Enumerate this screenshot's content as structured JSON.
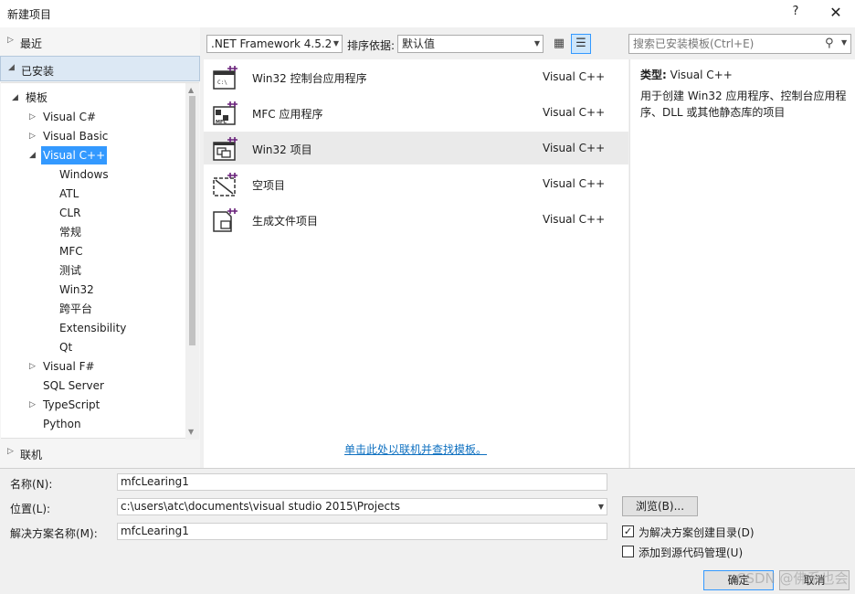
{
  "window": {
    "title": "新建项目",
    "help": "?",
    "close": "✕"
  },
  "nav": {
    "recent": "最近",
    "installed": "已安装",
    "online": "联机",
    "tree": [
      {
        "label": "模板",
        "arrow": "◢"
      },
      {
        "label": "Visual C#",
        "arrow": "▷"
      },
      {
        "label": "Visual Basic",
        "arrow": "▷"
      },
      {
        "label": "Visual C++",
        "arrow": "◢"
      },
      {
        "label": "Windows"
      },
      {
        "label": "ATL"
      },
      {
        "label": "CLR"
      },
      {
        "label": "常规"
      },
      {
        "label": "MFC"
      },
      {
        "label": "测试"
      },
      {
        "label": "Win32"
      },
      {
        "label": "跨平台"
      },
      {
        "label": "Extensibility"
      },
      {
        "label": "Qt"
      },
      {
        "label": "Visual F#",
        "arrow": "▷"
      },
      {
        "label": "SQL Server"
      },
      {
        "label": "TypeScript",
        "arrow": "▷"
      },
      {
        "label": "Python"
      }
    ]
  },
  "toolbar": {
    "framework": ".NET Framework 4.5.2",
    "sort_label": "排序依据:",
    "sort_value": "默认值",
    "search_placeholder": "搜索已安装模板(Ctrl+E)"
  },
  "templates": [
    {
      "name": "Win32 控制台应用程序",
      "lang": "Visual C++",
      "icon": "console-app-icon"
    },
    {
      "name": "MFC 应用程序",
      "lang": "Visual C++",
      "icon": "mfc-app-icon"
    },
    {
      "name": "Win32 项目",
      "lang": "Visual C++",
      "icon": "win32-project-icon"
    },
    {
      "name": "空项目",
      "lang": "Visual C++",
      "icon": "empty-project-icon"
    },
    {
      "name": "生成文件项目",
      "lang": "Visual C++",
      "icon": "makefile-project-icon"
    }
  ],
  "online_link": "单击此处以联机并查找模板。",
  "description": {
    "type_label": "类型:",
    "type_value": "Visual C++",
    "text": "用于创建 Win32 应用程序、控制台应用程序、DLL 或其他静态库的项目"
  },
  "form": {
    "name_label": "名称(N):",
    "name_value": "mfcLearing1",
    "location_label": "位置(L):",
    "location_value": "c:\\users\\atc\\documents\\visual studio 2015\\Projects",
    "solution_label": "解决方案名称(M):",
    "solution_value": "mfcLearing1",
    "browse": "浏览(B)...",
    "create_dir": "为解决方案创建目录(D)",
    "add_source_control": "添加到源代码管理(U)",
    "ok": "确定",
    "cancel": "取消",
    "watermark": "CSDN @佛系也会"
  },
  "colors": {
    "selection": "#3399ff",
    "link": "#0e70c0",
    "accent_plus": "#68217a"
  }
}
